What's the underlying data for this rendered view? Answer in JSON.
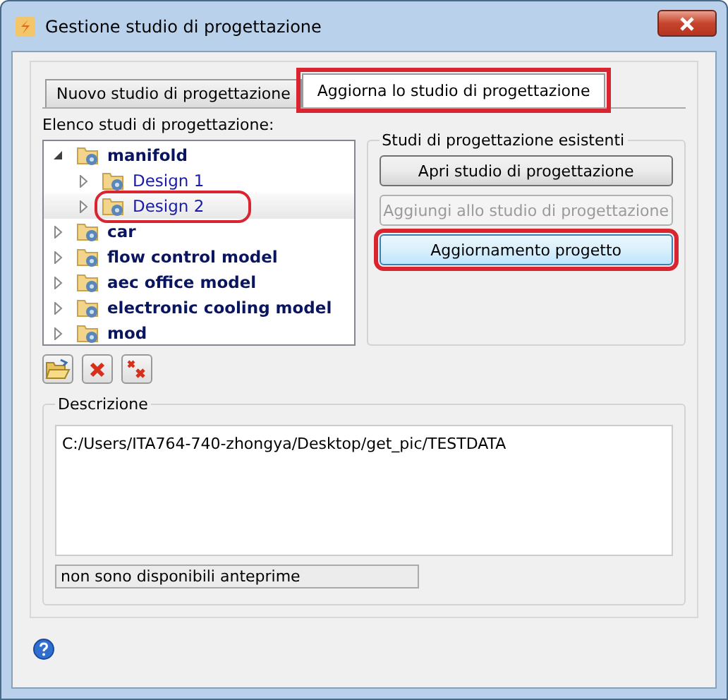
{
  "window": {
    "title": "Gestione studio di progettazione"
  },
  "tabs": [
    {
      "label": "Nuovo studio di progettazione",
      "selected": false,
      "highlighted": false
    },
    {
      "label": "Aggiorna lo studio di progettazione",
      "selected": true,
      "highlighted": true
    }
  ],
  "tree": {
    "label": "Elenco studi di progettazione:",
    "items": [
      {
        "label": "manifold",
        "expanded": true,
        "selected": false,
        "highlighted": false,
        "children": [
          {
            "label": "Design 1",
            "expanded": false,
            "selected": false,
            "highlighted": false
          },
          {
            "label": "Design 2",
            "expanded": false,
            "selected": true,
            "highlighted": true
          }
        ]
      },
      {
        "label": "car",
        "expanded": false,
        "selected": false,
        "highlighted": false
      },
      {
        "label": "flow control model",
        "expanded": false,
        "selected": false,
        "highlighted": false
      },
      {
        "label": "aec office model",
        "expanded": false,
        "selected": false,
        "highlighted": false
      },
      {
        "label": "electronic cooling model",
        "expanded": false,
        "selected": false,
        "highlighted": false
      },
      {
        "label": "mod",
        "expanded": false,
        "selected": false,
        "highlighted": false
      }
    ]
  },
  "existing_studies": {
    "title": "Studi di progettazione esistenti",
    "buttons": [
      {
        "label": "Apri studio di progettazione",
        "disabled": false,
        "focused": false,
        "highlighted": false
      },
      {
        "label": "Aggiungi allo studio di progettazione",
        "disabled": true,
        "focused": false,
        "highlighted": false
      },
      {
        "label": "Aggiornamento progetto",
        "disabled": false,
        "focused": true,
        "highlighted": true
      }
    ]
  },
  "tool_buttons": [
    {
      "kind": "open"
    },
    {
      "kind": "delete"
    },
    {
      "kind": "delete_all"
    }
  ],
  "description": {
    "title": "Descrizione",
    "text": "C:/Users/ITA764-740-zhongya/Desktop/get_pic/TESTDATA",
    "preview_status": "non sono disponibili anteprime"
  }
}
